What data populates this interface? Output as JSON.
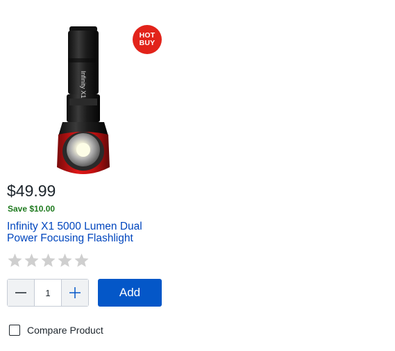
{
  "product": {
    "image_alt": "Infinity X1 flashlight",
    "image_text": "Infinity X1",
    "badge": {
      "line1": "HOT",
      "line2": "BUY",
      "color": "#e2231a"
    },
    "price": "$49.99",
    "savings": "Save $10.00",
    "title_line1": "Infinity X1 5000 Lumen Dual",
    "title_line2": "Power Focusing Flashlight",
    "rating": {
      "stars_filled": 0,
      "stars_total": 5,
      "star_icon": "star-icon"
    }
  },
  "quantity": {
    "value": "1",
    "decrement_icon": "minus-icon",
    "increment_icon": "plus-icon"
  },
  "actions": {
    "add_label": "Add"
  },
  "compare": {
    "label": "Compare Product",
    "checked": false
  },
  "colors": {
    "accent": "#0457c8",
    "link": "#0046be",
    "save": "#1e7a1e",
    "badge": "#e2231a"
  }
}
